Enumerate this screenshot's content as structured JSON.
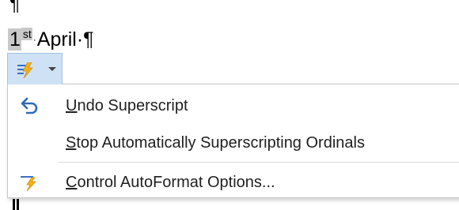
{
  "document": {
    "pilcrow_top": "¶",
    "date_day": "1",
    "date_suffix": "st",
    "date_separator": "·",
    "date_month": "April",
    "date_end": "·¶"
  },
  "autocorrect_button": {
    "icon": "lightning-bolt-icon",
    "dropdown_icon": "caret-down-icon",
    "accent_color": "#f2b21b",
    "fill_color": "#cfe1f5"
  },
  "menu": {
    "items": [
      {
        "icon": "undo-arrow-icon",
        "label_accel": "U",
        "label_rest": "ndo Superscript"
      },
      {
        "icon": "",
        "label_accel": "S",
        "label_rest": "top Automatically Superscripting Ordinals"
      },
      {
        "icon": "autoformat-bolt-icon",
        "label_accel": "C",
        "label_rest": "ontrol AutoFormat Options..."
      }
    ]
  }
}
